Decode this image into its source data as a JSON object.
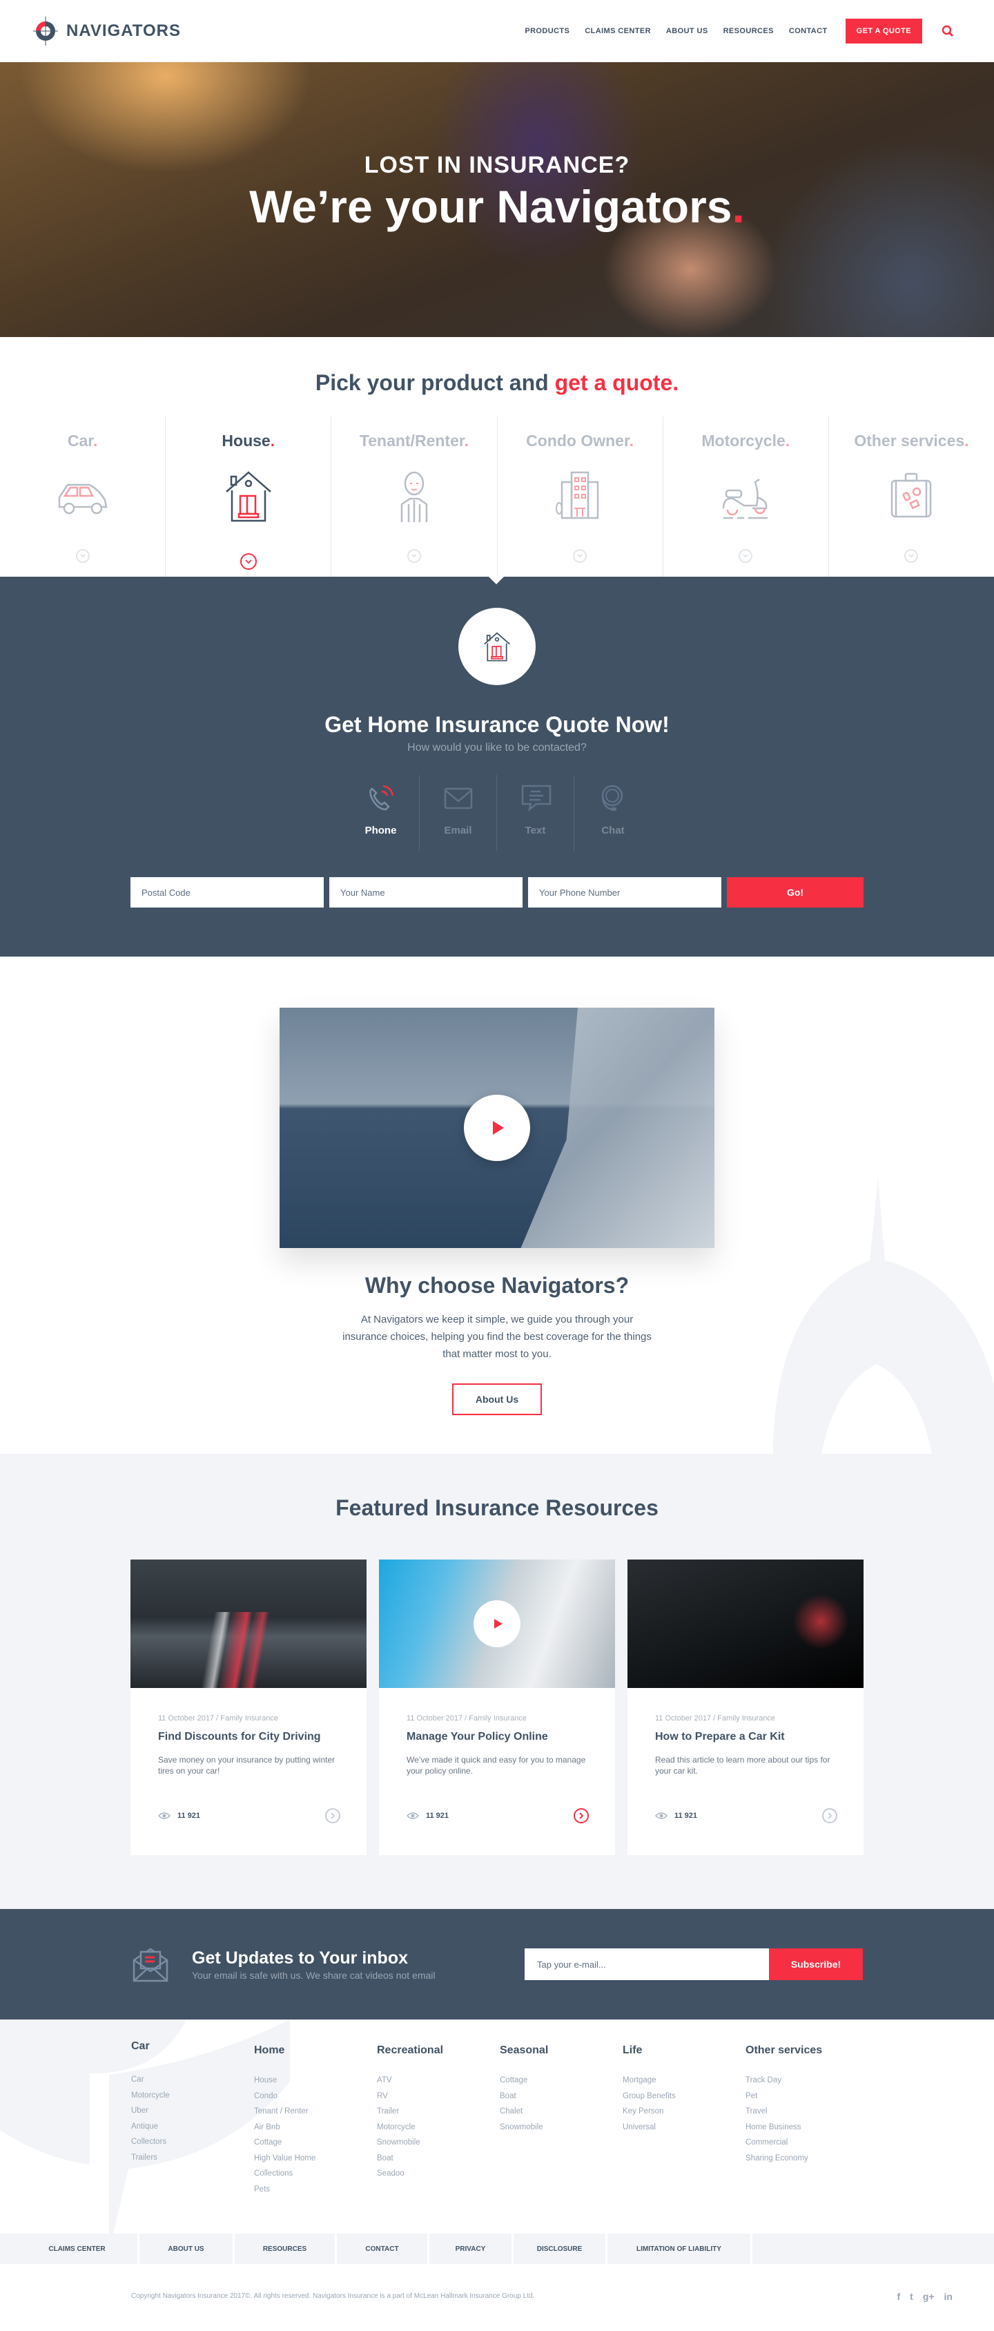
{
  "brand": {
    "name": "NAVIGATORS",
    "accent": "#f72f42",
    "navy": "#415264"
  },
  "nav": {
    "items": [
      "PRODUCTS",
      "CLAIMS CENTER",
      "ABOUT US",
      "RESOURCES",
      "CONTACT"
    ],
    "cta": "GET A QUOTE",
    "search_icon": "search-icon"
  },
  "hero": {
    "subtitle": "LOST IN INSURANCE?",
    "title": "We’re your Navigators",
    "title_dot": ".",
    "scroll_icon": "chevron-down-circle-icon"
  },
  "products": {
    "heading_start": "Pick your product and ",
    "heading_accent": "get a quote.",
    "items": [
      {
        "label": "Car",
        "icon": "car-icon",
        "active": false
      },
      {
        "label": "House",
        "icon": "house-icon",
        "active": true
      },
      {
        "label": "Tenant/Renter",
        "icon": "person-icon",
        "active": false
      },
      {
        "label": "Condo Owner",
        "icon": "building-icon",
        "active": false
      },
      {
        "label": "Motorcycle",
        "icon": "scooter-icon",
        "active": false
      },
      {
        "label": "Other services",
        "icon": "suitcase-icon",
        "active": false
      }
    ]
  },
  "quote": {
    "title": "Get Home Insurance Quote Now!",
    "subtitle": "How would you like to be contacted?",
    "contact_options": [
      {
        "label": "Phone",
        "icon": "phone-icon",
        "active": true
      },
      {
        "label": "Email",
        "icon": "email-icon",
        "active": false
      },
      {
        "label": "Text",
        "icon": "text-message-icon",
        "active": false
      },
      {
        "label": "Chat",
        "icon": "headset-icon",
        "active": false
      }
    ],
    "fields": {
      "postal_placeholder": "Postal Code",
      "name_placeholder": "Your Name",
      "phone_placeholder": "Your Phone Number"
    },
    "submit": "Go!"
  },
  "why": {
    "title": "Why choose Navigators?",
    "body": "At Navigators we keep it simple, we guide you through your insurance choices, helping you find the best coverage for the things that matter most to you.",
    "button": "About Us"
  },
  "resources": {
    "title": "Featured Insurance Resources",
    "cards": [
      {
        "meta": "11 October 2017 / Family Insurance",
        "title": "Find Discounts for City Driving",
        "text": "Save money on your insurance by putting winter tires on your car!",
        "views": "11 921",
        "has_video": false,
        "arrow_active": false
      },
      {
        "meta": "11 October 2017 / Family Insurance",
        "title": "Manage Your Policy Online",
        "text": "We’ve made it quick and easy for you to manage your policy online.",
        "views": "11 921",
        "has_video": true,
        "arrow_active": true
      },
      {
        "meta": "11 October 2017 / Family Insurance",
        "title": "How to Prepare a Car Kit",
        "text": "Read this article to learn more about our tips for your car kit.",
        "views": "11 921",
        "has_video": false,
        "arrow_active": false
      }
    ]
  },
  "newsletter": {
    "title": "Get Updates to Your inbox",
    "subtitle": "Your email is safe with us. We share cat videos not email",
    "placeholder": "Tap your e-mail...",
    "button": "Subscribe!"
  },
  "footer": {
    "columns": [
      {
        "title": "Car",
        "links": [
          "Car",
          "Motorcycle",
          "Uber",
          "Antique",
          "Collectors",
          "Trailers"
        ]
      },
      {
        "title": "Home",
        "links": [
          "House",
          "Condo",
          "Tenant / Renter",
          "Air Bnb",
          "Cottage",
          "High Value Home",
          "Collections",
          "Pets"
        ]
      },
      {
        "title": "Recreational",
        "links": [
          "ATV",
          "RV",
          "Trailer",
          "Motorcycle",
          "Snowmobile",
          "Boat",
          "Seadoo"
        ]
      },
      {
        "title": "Seasonal",
        "links": [
          "Cottage",
          "Boat",
          "Chalet",
          "Snowmobile"
        ]
      },
      {
        "title": "Life",
        "links": [
          "Mortgage",
          "Group Benefits",
          "Key Person",
          "Universal"
        ]
      },
      {
        "title": "Other services",
        "links": [
          "Track Day",
          "Pet",
          "Travel",
          "Home Business",
          "Commercial",
          "Sharing Economy"
        ]
      }
    ],
    "bottom_links": [
      "CLAIMS CENTER",
      "ABOUT US",
      "RESOURCES",
      "CONTACT",
      "PRIVACY",
      "DISCLOSURE",
      "LIMITATION OF LIABILITY"
    ],
    "copyright": "Copyright Navigators Insurance 2017©. All rights reserved. Navigators Insurance is a part of McLean Hallmark Insurance Group Ltd.",
    "social": [
      {
        "name": "facebook-icon",
        "glyph": "f"
      },
      {
        "name": "twitter-icon",
        "glyph": "🐦"
      },
      {
        "name": "google-plus-icon",
        "glyph": "g+"
      },
      {
        "name": "linkedin-icon",
        "glyph": "in"
      }
    ]
  }
}
